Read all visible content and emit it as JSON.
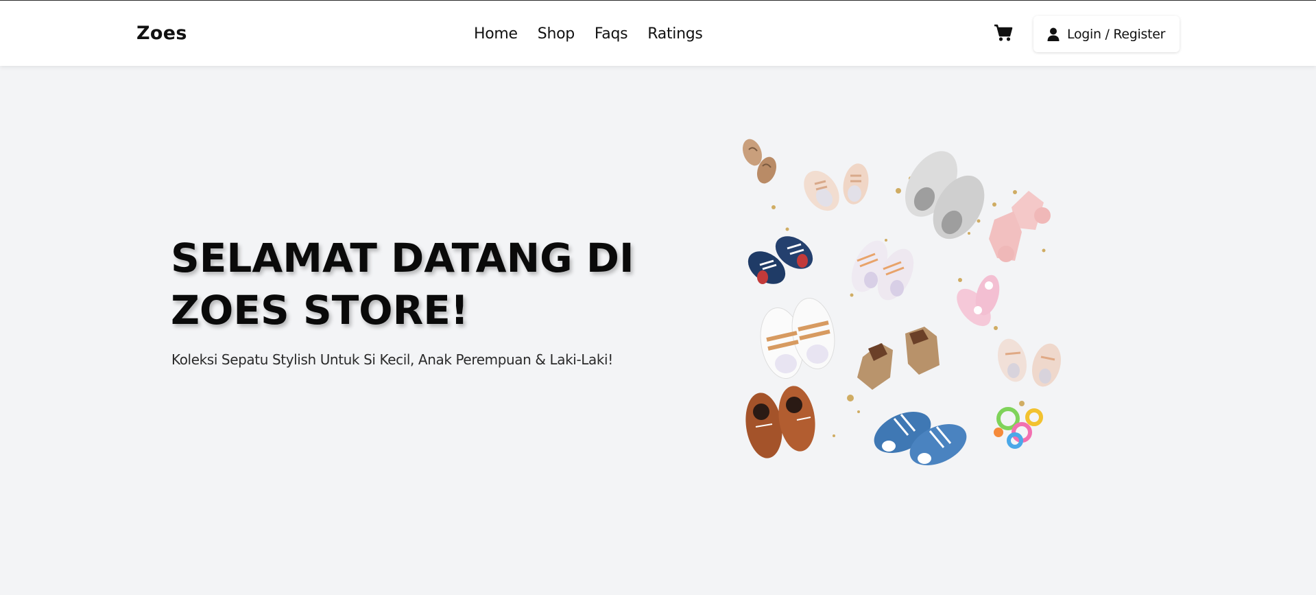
{
  "navbar": {
    "brand": "Zoes",
    "links": [
      "Home",
      "Shop",
      "Faqs",
      "Ratings"
    ],
    "cart_icon": "shopping-cart-icon",
    "login_label": "Login / Register",
    "login_icon": "user-icon"
  },
  "hero": {
    "title": "SELAMAT DATANG DI ZOES STORE!",
    "subtitle": "Koleksi Sepatu Stylish Untuk Si Kecil, Anak Perempuan & Laki-Laki!",
    "image_name": "baby-shoes-collection"
  },
  "colors": {
    "background": "#f3f4f6",
    "navbar": "#ffffff",
    "text": "#111111"
  }
}
